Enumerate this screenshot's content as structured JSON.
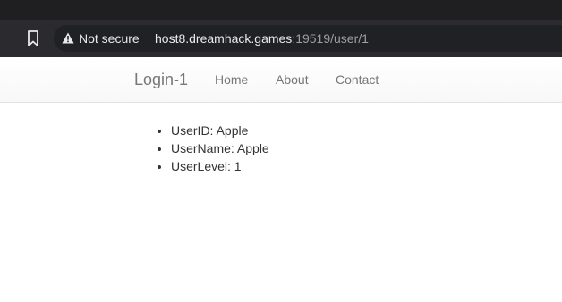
{
  "browser": {
    "security_label": "Not secure",
    "url_host": "host8.dreamhack.games",
    "url_rest": ":19519/user/1"
  },
  "navbar": {
    "brand": "Login-1",
    "links": [
      "Home",
      "About",
      "Contact"
    ]
  },
  "user_info": [
    "UserID: Apple",
    "UserName: Apple",
    "UserLevel: 1"
  ]
}
